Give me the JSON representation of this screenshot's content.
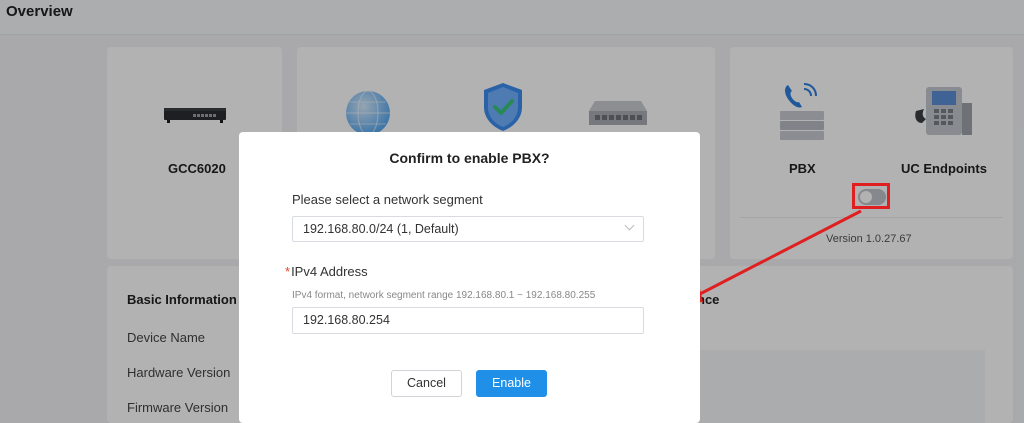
{
  "header": {
    "title": "Overview"
  },
  "devices": {
    "gcc_label": "GCC6020",
    "pbx_label": "PBX",
    "uc_label": "UC Endpoints",
    "version": "Version 1.0.27.67",
    "pbx_toggle_state": "off"
  },
  "basic_info": {
    "title": "Basic Information",
    "rows": [
      "Device Name",
      "Hardware Version",
      "Firmware Version"
    ]
  },
  "background_fragments": {
    "right_card_title_tail": "nce"
  },
  "dialog": {
    "title": "Confirm to enable PBX?",
    "segment_label": "Please select a network segment",
    "segment_value": "192.168.80.0/24 (1, Default)",
    "required_mark": "*",
    "ipv4_label": "IPv4 Address",
    "ipv4_hint": "IPv4 format, network segment range 192.168.80.1 ~ 192.168.80.255",
    "ipv4_value": "192.168.80.254",
    "cancel_label": "Cancel",
    "enable_label": "Enable"
  },
  "colors": {
    "primary": "#1f8fe8",
    "highlight": "#e02020",
    "required": "#e8452c"
  }
}
